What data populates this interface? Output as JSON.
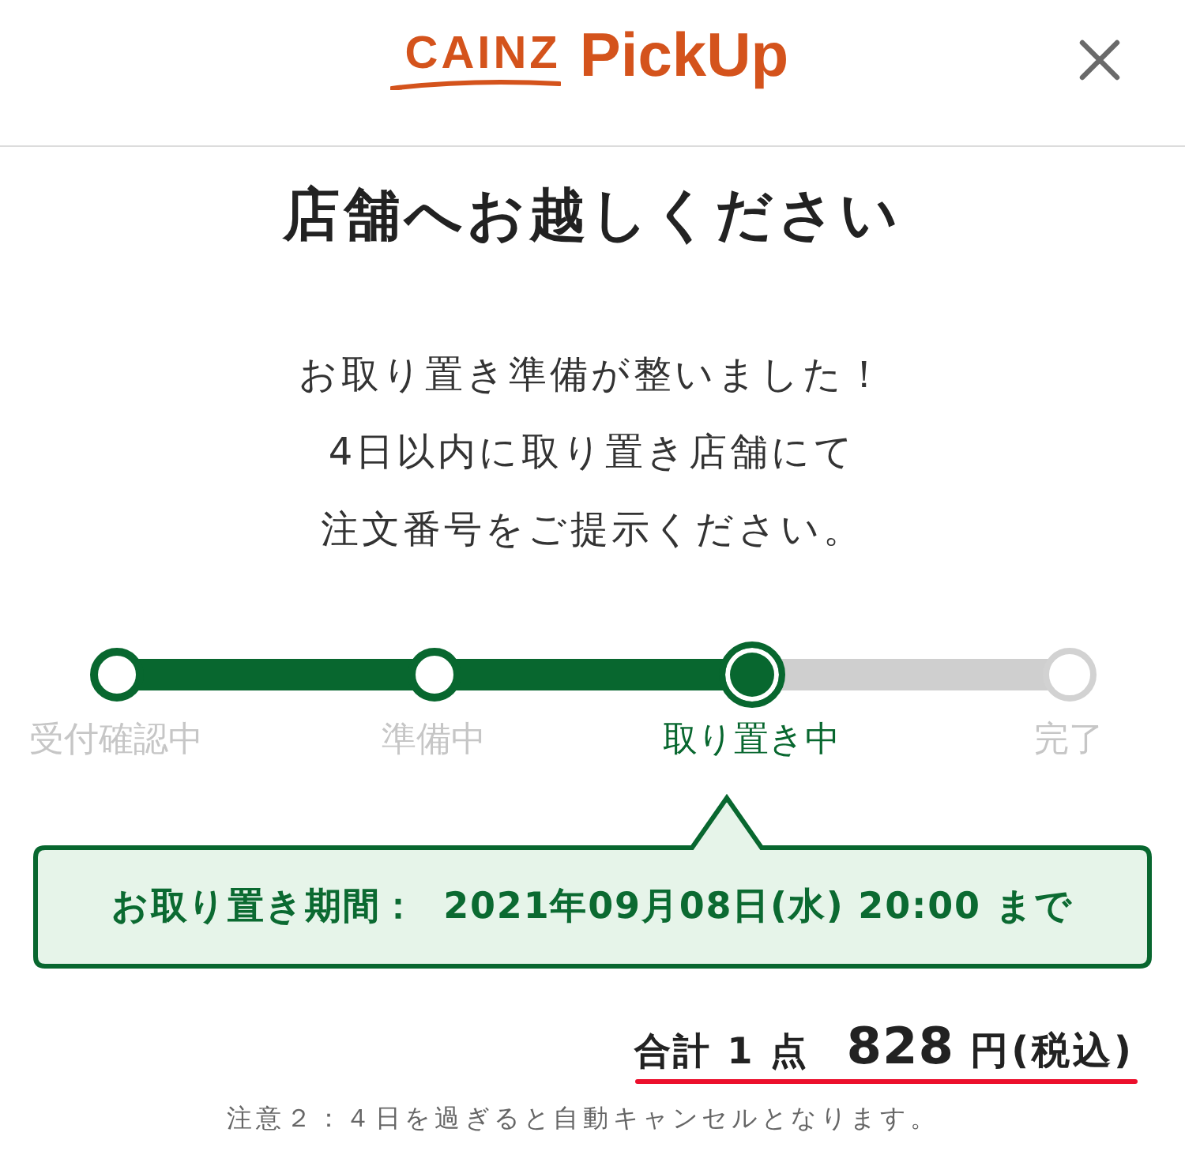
{
  "header": {
    "logo": {
      "brand": "CAINZ",
      "service": "PickUp"
    }
  },
  "title": "店舗へお越しください",
  "message": [
    "お取り置き準備が整いました！",
    "4日以内に取り置き店舗にて",
    "注文番号をご提示ください。"
  ],
  "steps": [
    {
      "label": "受付確認中",
      "completed": true,
      "selected": false
    },
    {
      "label": "準備中",
      "completed": true,
      "selected": false
    },
    {
      "label": "取り置き中",
      "completed": false,
      "selected": true
    },
    {
      "label": "完了",
      "completed": false,
      "selected": false
    }
  ],
  "pickup_period": {
    "label": "お取り置き期間：",
    "value": "2021年09月08日(水) 20:00 まで"
  },
  "total": {
    "count": "合計 1 点",
    "amount": "828",
    "unit": "円(税込)",
    "underlined": true
  },
  "note": "注意２：４日を過ぎると自動キャンセルとなります。"
}
